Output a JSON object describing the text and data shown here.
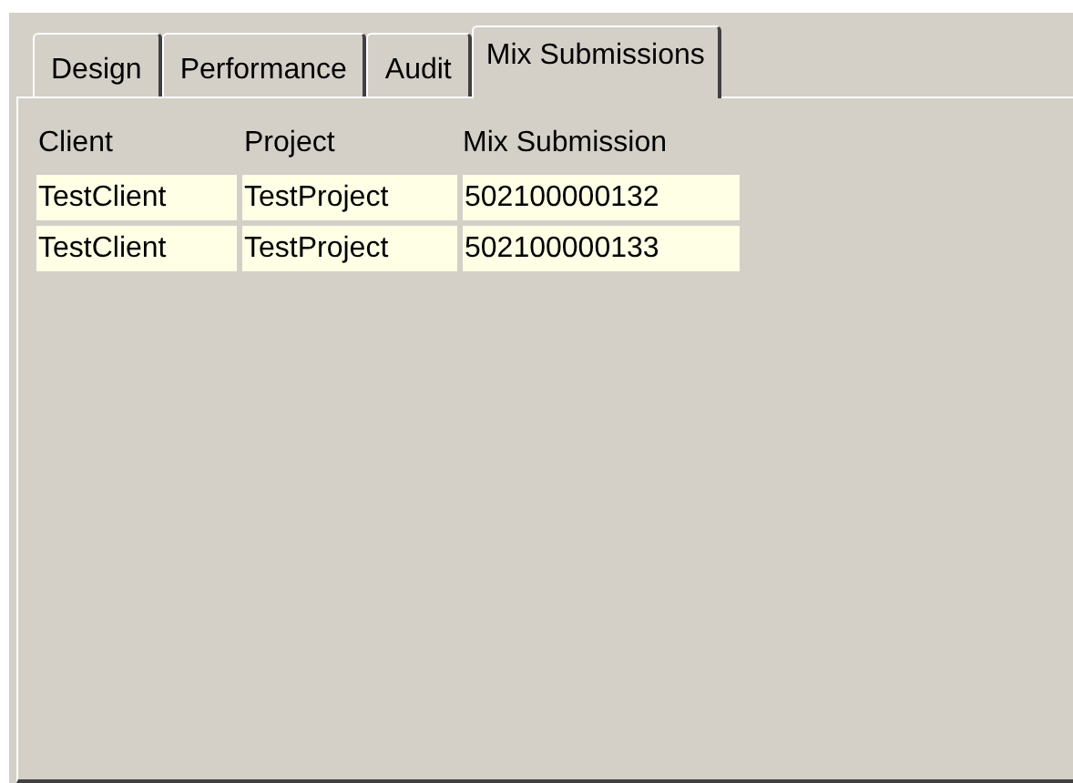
{
  "tabs": [
    {
      "label": "Design",
      "selected": false
    },
    {
      "label": "Performance",
      "selected": false
    },
    {
      "label": "Audit",
      "selected": false
    },
    {
      "label": "Mix Submissions",
      "selected": true
    }
  ],
  "table": {
    "columns": [
      "Client",
      "Project",
      "Mix Submission"
    ],
    "rows": [
      [
        "TestClient",
        "TestProject",
        "502100000132"
      ],
      [
        "TestClient",
        "TestProject",
        "502100000133"
      ]
    ]
  }
}
